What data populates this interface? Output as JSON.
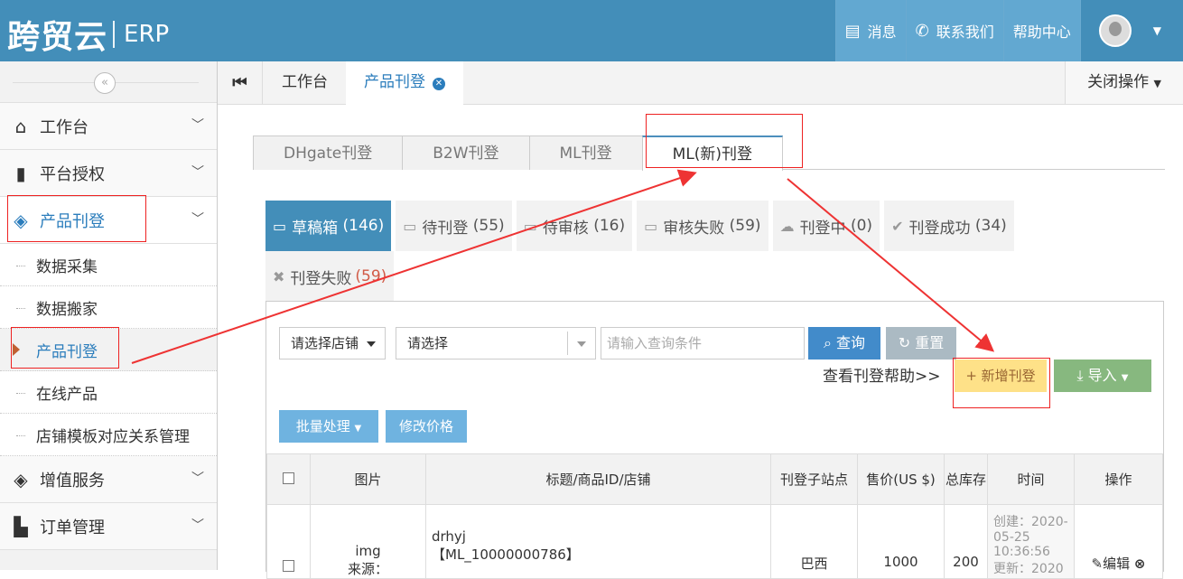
{
  "header": {
    "logo": "跨贸云",
    "product": "ERP",
    "nav": [
      {
        "icon": "message-icon",
        "label": "消息"
      },
      {
        "icon": "phone-icon",
        "label": "联系我们"
      },
      {
        "label": "帮助中心"
      }
    ]
  },
  "sidebar": {
    "collapse": "«",
    "menus": [
      {
        "label": "工作台"
      },
      {
        "label": "平台授权"
      },
      {
        "label": "产品刊登"
      }
    ],
    "subs": [
      "数据采集",
      "数据搬家",
      "产品刊登",
      "在线产品",
      "店铺模板对应关系管理"
    ],
    "menus_after": [
      {
        "label": "增值服务"
      },
      {
        "label": "订单管理"
      }
    ]
  },
  "tabs": {
    "items": [
      "工作台",
      "产品刊登"
    ],
    "close_ops": "关闭操作"
  },
  "platform_tabs": [
    "DHgate刊登",
    "B2W刊登",
    "ML刊登",
    "ML(新)刊登"
  ],
  "status_tabs": [
    {
      "label": "草稿箱",
      "count": "(146)"
    },
    {
      "label": "待刊登",
      "count": "(55)"
    },
    {
      "label": "待审核",
      "count": "(16)"
    },
    {
      "label": "审核失败",
      "count": "(59)"
    },
    {
      "label": "刊登中",
      "count": "(0)"
    },
    {
      "label": "刊登成功",
      "count": "(34)"
    },
    {
      "label": "刊登失败",
      "count": "(59)"
    }
  ],
  "filters": {
    "shop_select": "请选择店铺",
    "select2": "请选择",
    "query_placeholder": "请输入查询条件",
    "search": "查询",
    "reset": "重置",
    "help_link": "查看刊登帮助>>",
    "add": "新增刊登",
    "import": "导入",
    "batch": "批量处理",
    "edit_price": "修改价格"
  },
  "table": {
    "headers": [
      "",
      "图片",
      "标题/商品ID/店铺",
      "刊登子站点",
      "售价(US $)",
      "总库存",
      "时间",
      "操作"
    ],
    "row": {
      "image": "img",
      "image_sub": "来源：",
      "title": "drhyj",
      "item_id": "【ML_10000000786】",
      "site": "巴西",
      "price": "1000",
      "stock": "200",
      "time": "创建：2020-05-25 10:36:56",
      "time_more": "更新：2020",
      "edit": "编辑"
    }
  }
}
